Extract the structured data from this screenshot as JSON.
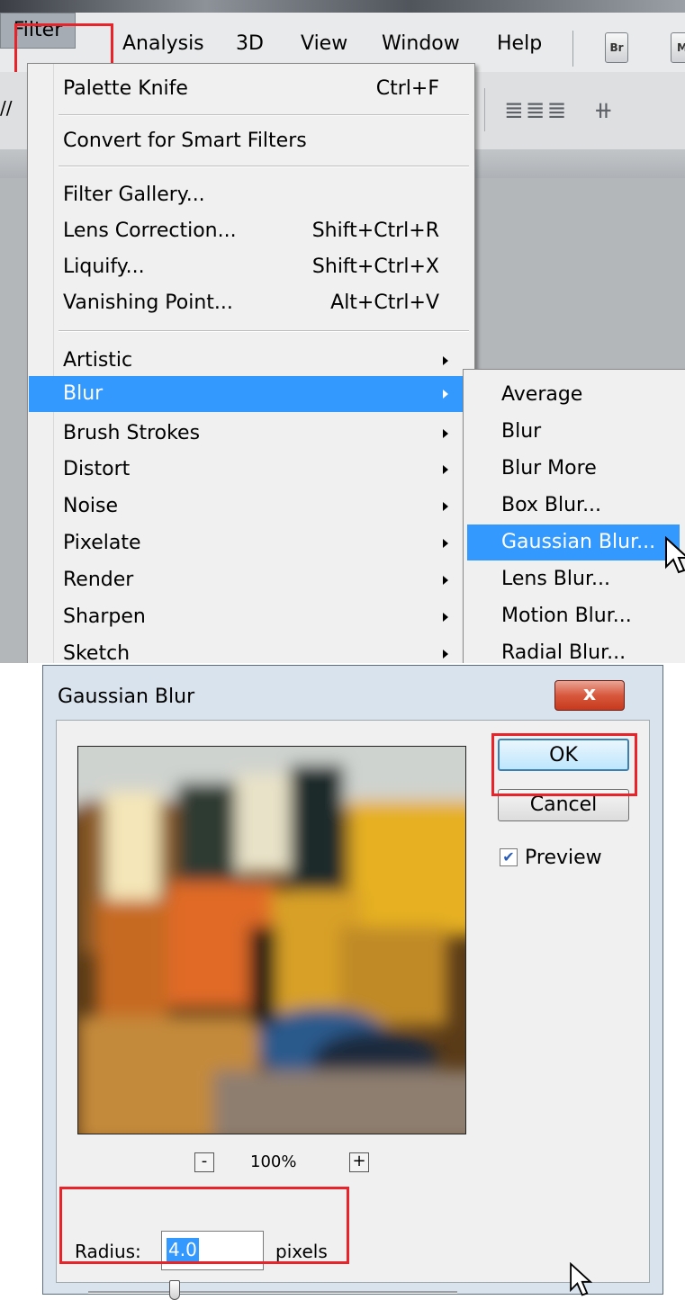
{
  "menubar": {
    "items": [
      "Filter",
      "Analysis",
      "3D",
      "View",
      "Window",
      "Help"
    ],
    "toolbar_icons": [
      "Br",
      "M"
    ]
  },
  "filter_menu": {
    "top_item": {
      "label": "Palette Knife",
      "shortcut": "Ctrl+F"
    },
    "smart": "Convert for Smart Filters",
    "group1": [
      {
        "label": "Filter Gallery...",
        "shortcut": ""
      },
      {
        "label": "Lens Correction...",
        "shortcut": "Shift+Ctrl+R"
      },
      {
        "label": "Liquify...",
        "shortcut": "Shift+Ctrl+X"
      },
      {
        "label": "Vanishing Point...",
        "shortcut": "Alt+Ctrl+V"
      }
    ],
    "submenus": [
      "Artistic",
      "Blur",
      "Brush Strokes",
      "Distort",
      "Noise",
      "Pixelate",
      "Render",
      "Sharpen",
      "Sketch"
    ],
    "highlighted": "Blur"
  },
  "blur_submenu": {
    "items": [
      "Average",
      "Blur",
      "Blur More",
      "Box Blur...",
      "Gaussian Blur...",
      "Lens Blur...",
      "Motion Blur...",
      "Radial Blur..."
    ],
    "highlighted": "Gaussian Blur..."
  },
  "dialog": {
    "title": "Gaussian Blur",
    "close_label": "x",
    "ok_label": "OK",
    "cancel_label": "Cancel",
    "preview_label": "Preview",
    "preview_checked": true,
    "zoom_minus": "-",
    "zoom_plus": "+",
    "zoom_level": "100%",
    "radius_label": "Radius:",
    "radius_value": "4.0",
    "radius_unit": "pixels"
  },
  "colors": {
    "highlight": "#3399ff",
    "annotation_box": "#e8242a",
    "close_button": "#c63a1e"
  }
}
